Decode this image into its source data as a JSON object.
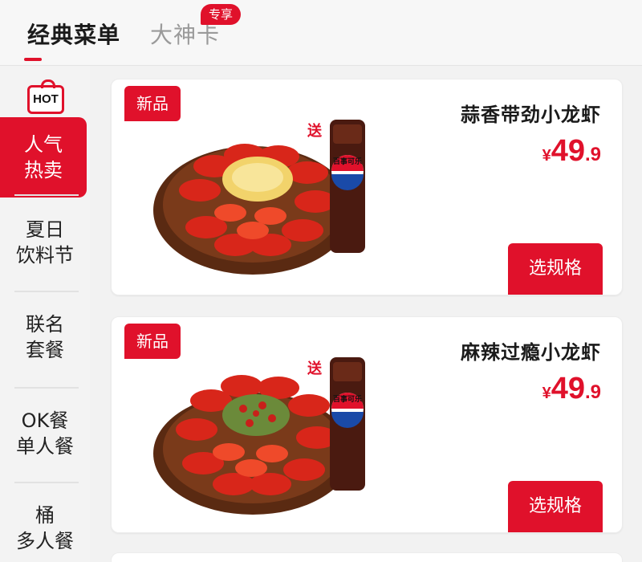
{
  "tabs": {
    "classic_menu": "经典菜单",
    "master_card": "大神卡",
    "exclusive_badge": "专享"
  },
  "sidebar": {
    "hot_tag": "HOT",
    "items": [
      {
        "line1": "人气",
        "line2": "热卖"
      },
      {
        "line1": "夏日",
        "line2": "饮料节"
      },
      {
        "line1": "联名",
        "line2": "套餐"
      },
      {
        "line1": "OK餐",
        "line2": "单人餐"
      },
      {
        "line1": "桶",
        "line2": "多人餐"
      }
    ]
  },
  "products": [
    {
      "tag": "新品",
      "name": "蒜香带劲小龙虾",
      "currency": "¥",
      "price_int": "49",
      "price_dec": ".9",
      "gift_label": "送",
      "drink_brand": "百事可乐",
      "button": "选规格"
    },
    {
      "tag": "新品",
      "name": "麻辣过瘾小龙虾",
      "currency": "¥",
      "price_int": "49",
      "price_dec": ".9",
      "gift_label": "送",
      "drink_brand": "百事可乐",
      "button": "选规格"
    }
  ],
  "colors": {
    "accent": "#e0112b",
    "garlic": "#f2d36b",
    "pepper": "#6b8a3a",
    "cola": "#4a1a10"
  }
}
